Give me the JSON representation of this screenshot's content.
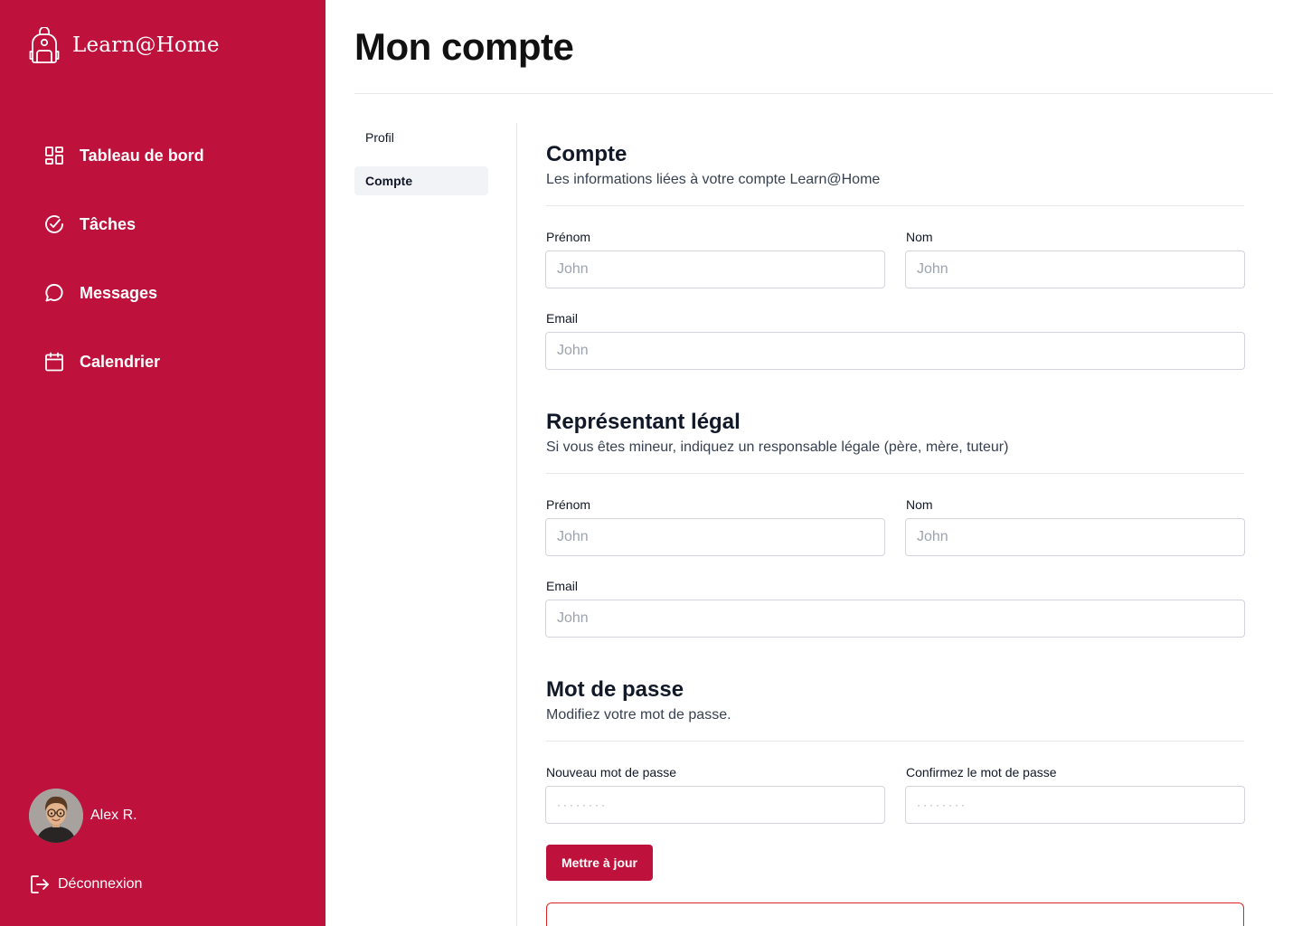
{
  "app": {
    "brand": "Learn@Home",
    "brand_icon": "backpack-icon"
  },
  "theme": {
    "accent": "#be123c",
    "danger_border": "#dc2626"
  },
  "sidebar": {
    "items": [
      {
        "label": "Tableau de bord",
        "icon": "dashboard-icon"
      },
      {
        "label": "Tâches",
        "icon": "check-circle-icon"
      },
      {
        "label": "Messages",
        "icon": "chat-bubble-icon"
      },
      {
        "label": "Calendrier",
        "icon": "calendar-icon"
      }
    ],
    "user": {
      "name": "Alex R."
    },
    "logout_label": "Déconnexion"
  },
  "main": {
    "title": "Mon compte",
    "subnav": [
      {
        "label": "Profil",
        "active": false
      },
      {
        "label": "Compte",
        "active": true
      }
    ],
    "account": {
      "title": "Compte",
      "description": "Les informations liées à votre compte Learn@Home",
      "first_name_label": "Prénom",
      "first_name_placeholder": "John",
      "last_name_label": "Nom",
      "last_name_placeholder": "John",
      "email_label": "Email",
      "email_placeholder": "John"
    },
    "guardian": {
      "title": "Représentant légal",
      "description": "Si vous êtes mineur, indiquez un responsable légale (père, mère, tuteur)",
      "first_name_label": "Prénom",
      "first_name_placeholder": "John",
      "last_name_label": "Nom",
      "last_name_placeholder": "John",
      "email_label": "Email",
      "email_placeholder": "John"
    },
    "password": {
      "title": "Mot de passe",
      "description": "Modifiez votre mot de passe.",
      "new_label": "Nouveau mot de passe",
      "new_placeholder": "········",
      "confirm_label": "Confirmez le mot de passe",
      "confirm_placeholder": "········",
      "submit_label": "Mettre à jour"
    }
  }
}
